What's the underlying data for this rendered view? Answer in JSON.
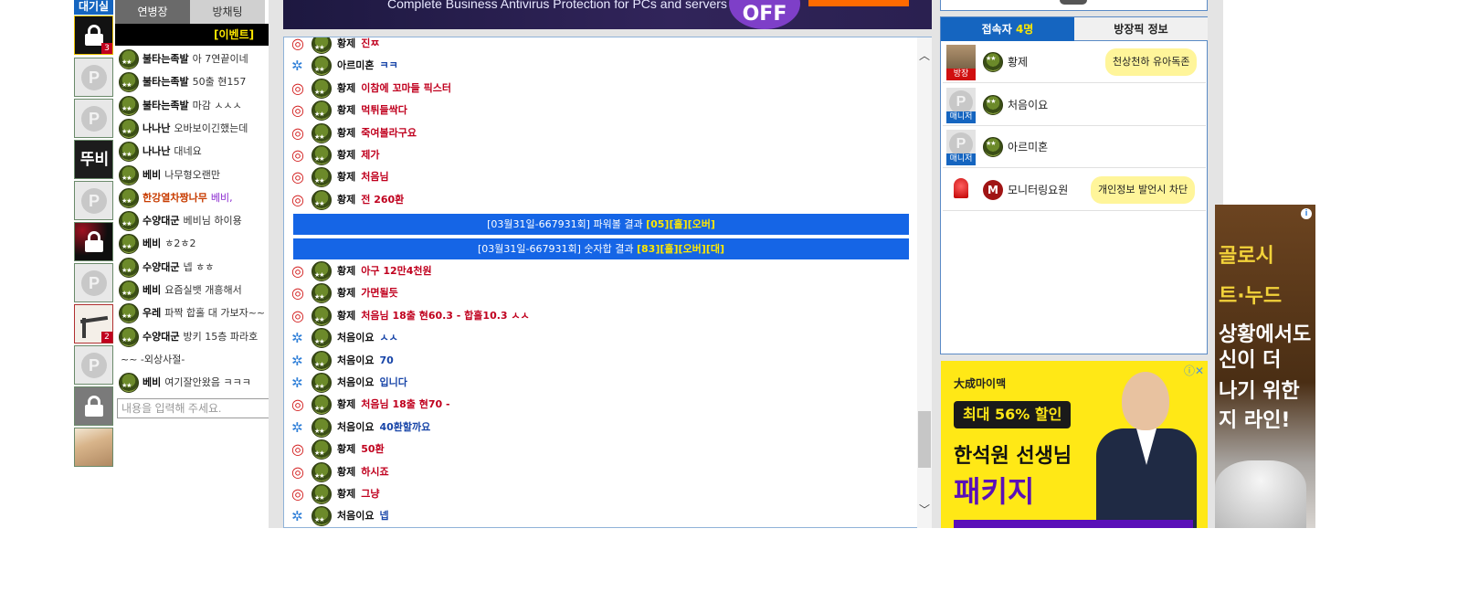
{
  "sidebar": {
    "wait_tab": "대기실",
    "avatars": [
      {
        "type": "lock",
        "badge": "3"
      },
      {
        "type": "p"
      },
      {
        "type": "p"
      },
      {
        "type": "text",
        "text": "뚜비"
      },
      {
        "type": "p"
      },
      {
        "type": "lock-dark"
      },
      {
        "type": "p"
      },
      {
        "type": "tool",
        "badge": "2"
      },
      {
        "type": "p"
      },
      {
        "type": "lock-grey"
      },
      {
        "type": "photo"
      }
    ]
  },
  "left_chat": {
    "tabs": [
      "연병장",
      "방채팅"
    ],
    "event_text": "[이벤트]",
    "messages": [
      {
        "nick": "불타는족발",
        "text": "아 7연끝이네"
      },
      {
        "nick": "불타는족발",
        "text": "50출 현157"
      },
      {
        "nick": "불타는족발",
        "text": "마감 ㅅㅅㅅ"
      },
      {
        "nick": "나나난",
        "text": "오바보이긴했는데"
      },
      {
        "nick": "나나난",
        "text": "대네요"
      },
      {
        "nick": "베비",
        "text": "나무형오랜만"
      },
      {
        "nick": "한강열차짱나무",
        "text": "베비,",
        "nick_color": "#c83c00",
        "text_color": "#8a28d0"
      },
      {
        "nick": "수양대군",
        "text": "베비님 하이용"
      },
      {
        "nick": "베비",
        "text": "ㅎ2ㅎ2"
      },
      {
        "nick": "수양대군",
        "text": "넵 ㅎㅎ"
      },
      {
        "nick": "베비",
        "text": "요즘실뱃 개흥해서"
      },
      {
        "nick": "우레",
        "text": "파짝 합홀 대 가보자~~"
      },
      {
        "nick": "수양대군",
        "text": "방키 15층 파라호"
      },
      {
        "sys": "~~         -외상사절-"
      },
      {
        "nick": "베비",
        "text": "여기잘안왔음 ㅋㅋㅋ"
      }
    ],
    "input_placeholder": "내용을 입력해 주세요."
  },
  "top_ad": {
    "text": "Complete Business Antivirus Protection for PCs and servers",
    "badge": "OFF"
  },
  "chat": {
    "messages": [
      {
        "icon": "red",
        "nick": "황제",
        "text": "진ㅉ",
        "color": "red"
      },
      {
        "icon": "blue",
        "nick": "아르미혼",
        "text": "ㅋㅋ",
        "color": "blue"
      },
      {
        "icon": "red",
        "nick": "황제",
        "text": "이참에 꼬마들 픽스터",
        "color": "red"
      },
      {
        "icon": "red",
        "nick": "황제",
        "text": "먹튀들싹다",
        "color": "red"
      },
      {
        "icon": "red",
        "nick": "황제",
        "text": "죽여볼라구요",
        "color": "red"
      },
      {
        "icon": "red",
        "nick": "황제",
        "text": "제가",
        "color": "red"
      },
      {
        "icon": "red",
        "nick": "황제",
        "text": "처음님",
        "color": "red"
      },
      {
        "icon": "red",
        "nick": "황제",
        "text": "전 260환",
        "color": "red"
      }
    ],
    "system_bars": [
      {
        "prefix": "[03월31일-667931회] 파워볼 결과 ",
        "result": "[05][홀][오버]"
      },
      {
        "prefix": "[03월31일-667931회] 숫자합 결과 ",
        "result": "[83][홀][오버][대]"
      }
    ],
    "messages2": [
      {
        "icon": "red",
        "nick": "황제",
        "text": "아구 12만4천원",
        "color": "red"
      },
      {
        "icon": "red",
        "nick": "황제",
        "text": "가면될듯",
        "color": "red"
      },
      {
        "icon": "red",
        "nick": "황제",
        "text": "처음님 18출 현60.3 - 합홀10.3 ㅅㅅ",
        "color": "red"
      },
      {
        "icon": "blue",
        "nick": "처음이요",
        "text": "ㅅㅅ",
        "color": "blue"
      },
      {
        "icon": "blue",
        "nick": "처음이요",
        "text": "70",
        "color": "blue"
      },
      {
        "icon": "blue",
        "nick": "처음이요",
        "text": "입니다",
        "color": "blue"
      },
      {
        "icon": "red",
        "nick": "황제",
        "text": "처음님 18출 현70 -",
        "color": "red"
      },
      {
        "icon": "blue",
        "nick": "처음이요",
        "text": "40환할까요",
        "color": "blue"
      },
      {
        "icon": "red",
        "nick": "황제",
        "text": "50환",
        "color": "red"
      },
      {
        "icon": "red",
        "nick": "황제",
        "text": "하시죠",
        "color": "red"
      },
      {
        "icon": "red",
        "nick": "황제",
        "text": "그냥",
        "color": "red"
      },
      {
        "icon": "blue",
        "nick": "처음이요",
        "text": "넵",
        "color": "blue"
      }
    ]
  },
  "users_panel": {
    "tab_users_prefix": "접속자 ",
    "tab_users_count": "4명",
    "tab_room_info": "방장픽 정보",
    "users": [
      {
        "name": "황제",
        "role": "방장",
        "role_color": "red",
        "avatar": "king",
        "bubble": "천상천하 유아독존"
      },
      {
        "name": "처음이요",
        "role": "매니저",
        "role_color": "blue",
        "avatar": "p",
        "bubble": ""
      },
      {
        "name": "아르미혼",
        "role": "매니저",
        "role_color": "blue",
        "avatar": "p",
        "bubble": ""
      },
      {
        "name": "모니터링요원",
        "role": "",
        "role_color": "",
        "avatar": "siren",
        "bubble": "개인정보 발언시 차단",
        "cap": "M"
      }
    ]
  },
  "ad_bottom": {
    "brand": "大成마이맥",
    "tag": "최대 56% 할인",
    "teacher": "한석원 선생님",
    "package": "패키지"
  },
  "ad_side": {
    "lines": [
      "골로시",
      "트·누드",
      "상황에서도",
      "신이 더",
      "나기 위한",
      "지 라인!"
    ]
  }
}
